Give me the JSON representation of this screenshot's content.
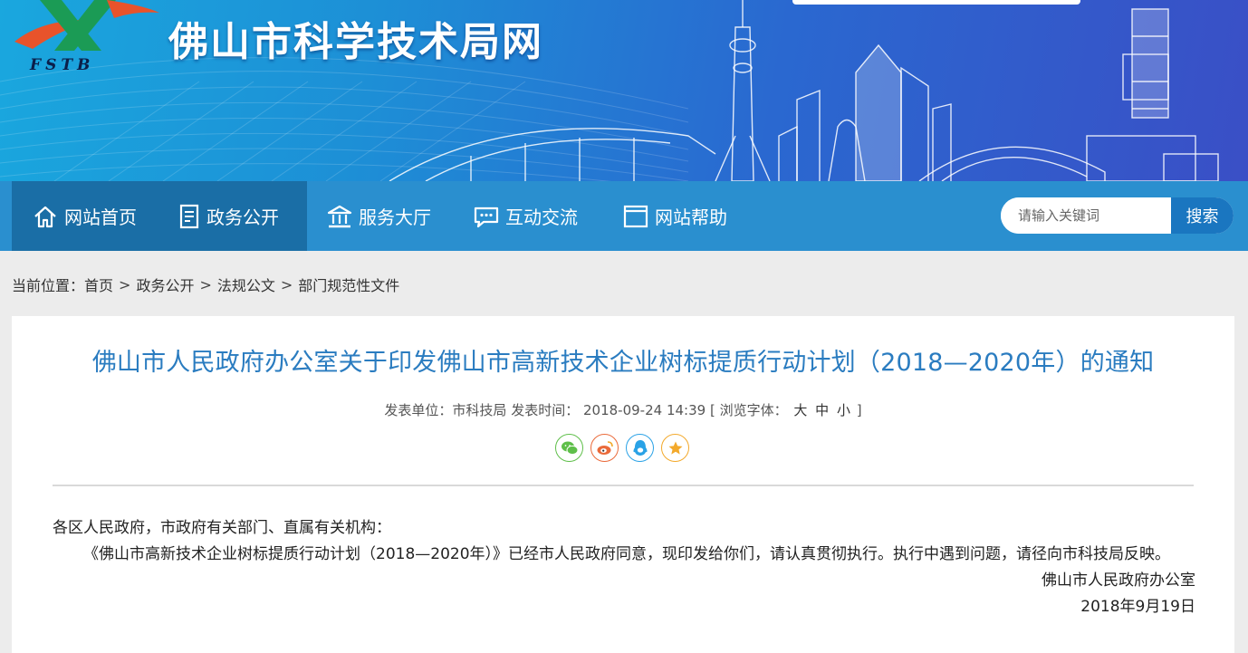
{
  "header": {
    "site_title": "佛山市科学技术局网",
    "logo_letters": "FSTB"
  },
  "nav": {
    "items": [
      {
        "label": "网站首页",
        "icon": "home-icon",
        "active": true
      },
      {
        "label": "政务公开",
        "icon": "document-icon",
        "active": false
      },
      {
        "label": "服务大厅",
        "icon": "building-icon",
        "active": false
      },
      {
        "label": "互动交流",
        "icon": "chat-icon",
        "active": false
      },
      {
        "label": "网站帮助",
        "icon": "window-icon",
        "active": false
      }
    ],
    "search_placeholder": "请输入关键词",
    "search_button": "搜索"
  },
  "breadcrumb": {
    "prefix": "当前位置：",
    "items": [
      "首页",
      "政务公开",
      "法规公文",
      "部门规范性文件"
    ],
    "separator": ">"
  },
  "article": {
    "title": "佛山市人民政府办公室关于印发佛山市高新技术企业树标提质行动计划（2018—2020年）的通知",
    "meta": {
      "unit_label": "发表单位：",
      "unit": "市科技局",
      "time_label": "发表时间：",
      "time": "2018-09-24 14:39",
      "font_label": "[ 浏览字体：",
      "font_large": "大",
      "font_medium": "中",
      "font_small": "小",
      "font_close": "]"
    },
    "share_icons": [
      "wechat-icon",
      "weibo-icon",
      "qq-icon",
      "favorite-icon"
    ],
    "salutation": "各区人民政府，市政府有关部门、直属有关机构：",
    "paragraph": "《佛山市高新技术企业树标提质行动计划（2018—2020年）》已经市人民政府同意，现印发给你们，请认真贯彻执行。执行中遇到问题，请径向市科技局反映。",
    "signature": "佛山市人民政府办公室",
    "date": "2018年9月19日"
  },
  "colors": {
    "nav_bg": "#2a8fcf",
    "nav_active": "#1a6ea6",
    "title_blue": "#2a7cc0",
    "search_btn": "#1a76c0"
  }
}
